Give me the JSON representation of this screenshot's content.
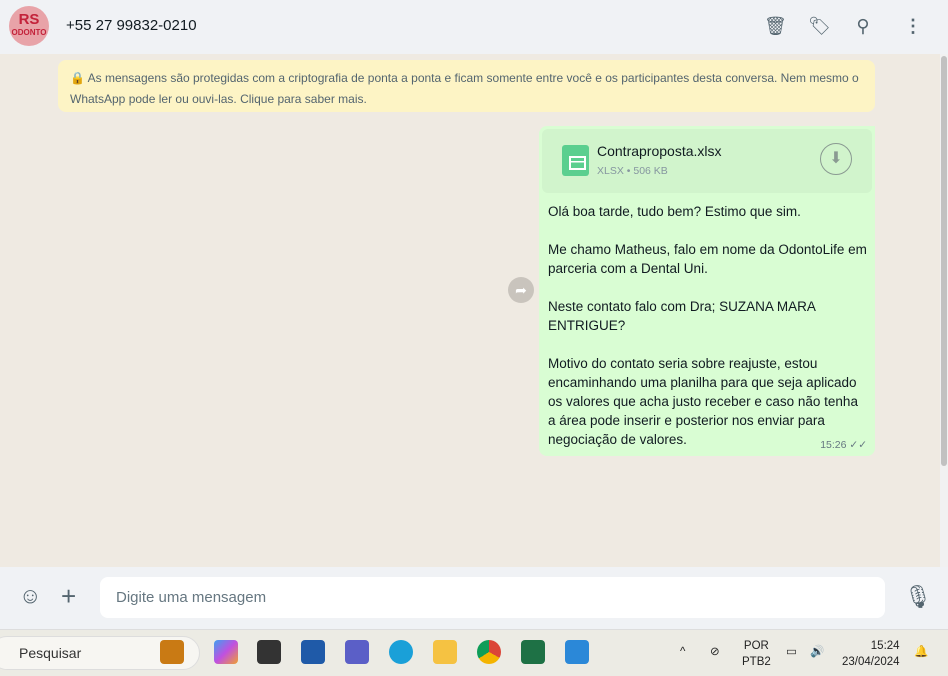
{
  "header": {
    "contact": "+55 27 99832-0210",
    "avatar_text": "RS ODONTO",
    "icons": [
      "trash-icon",
      "label-icon",
      "search-icon",
      "menu-icon"
    ]
  },
  "notice": "🔒 As mensagens são protegidas com a criptografia de ponta a ponta e ficam somente entre você e os participantes desta conversa. Nem mesmo o WhatsApp pode ler ou ouvi-las. Clique para saber mais.",
  "message": {
    "file_name": "Contraproposta.xlsx",
    "file_meta": "XLSX • 506 KB",
    "text": "Olá boa tarde, tudo bem? Estimo que sim.\n\nMe chamo Matheus, falo em nome da OdontoLife em parceria com a Dental Uni.\n\nNeste contato falo com Dra; SUZANA MARA ENTRIGUE?\n\nMotivo do contato seria sobre reajuste, estou encaminhando uma planilha para que seja aplicado os valores que acha justo receber e caso não tenha a área pode inserir e posterior nos enviar para negociação de valores.",
    "time": "15:26 ✓✓"
  },
  "composer": {
    "placeholder": "Digite uma mensagem"
  },
  "taskbar": {
    "search": "Pesquisar",
    "lang1": "POR",
    "lang2": "PTB2",
    "time": "15:24",
    "date": "23/04/2024"
  }
}
